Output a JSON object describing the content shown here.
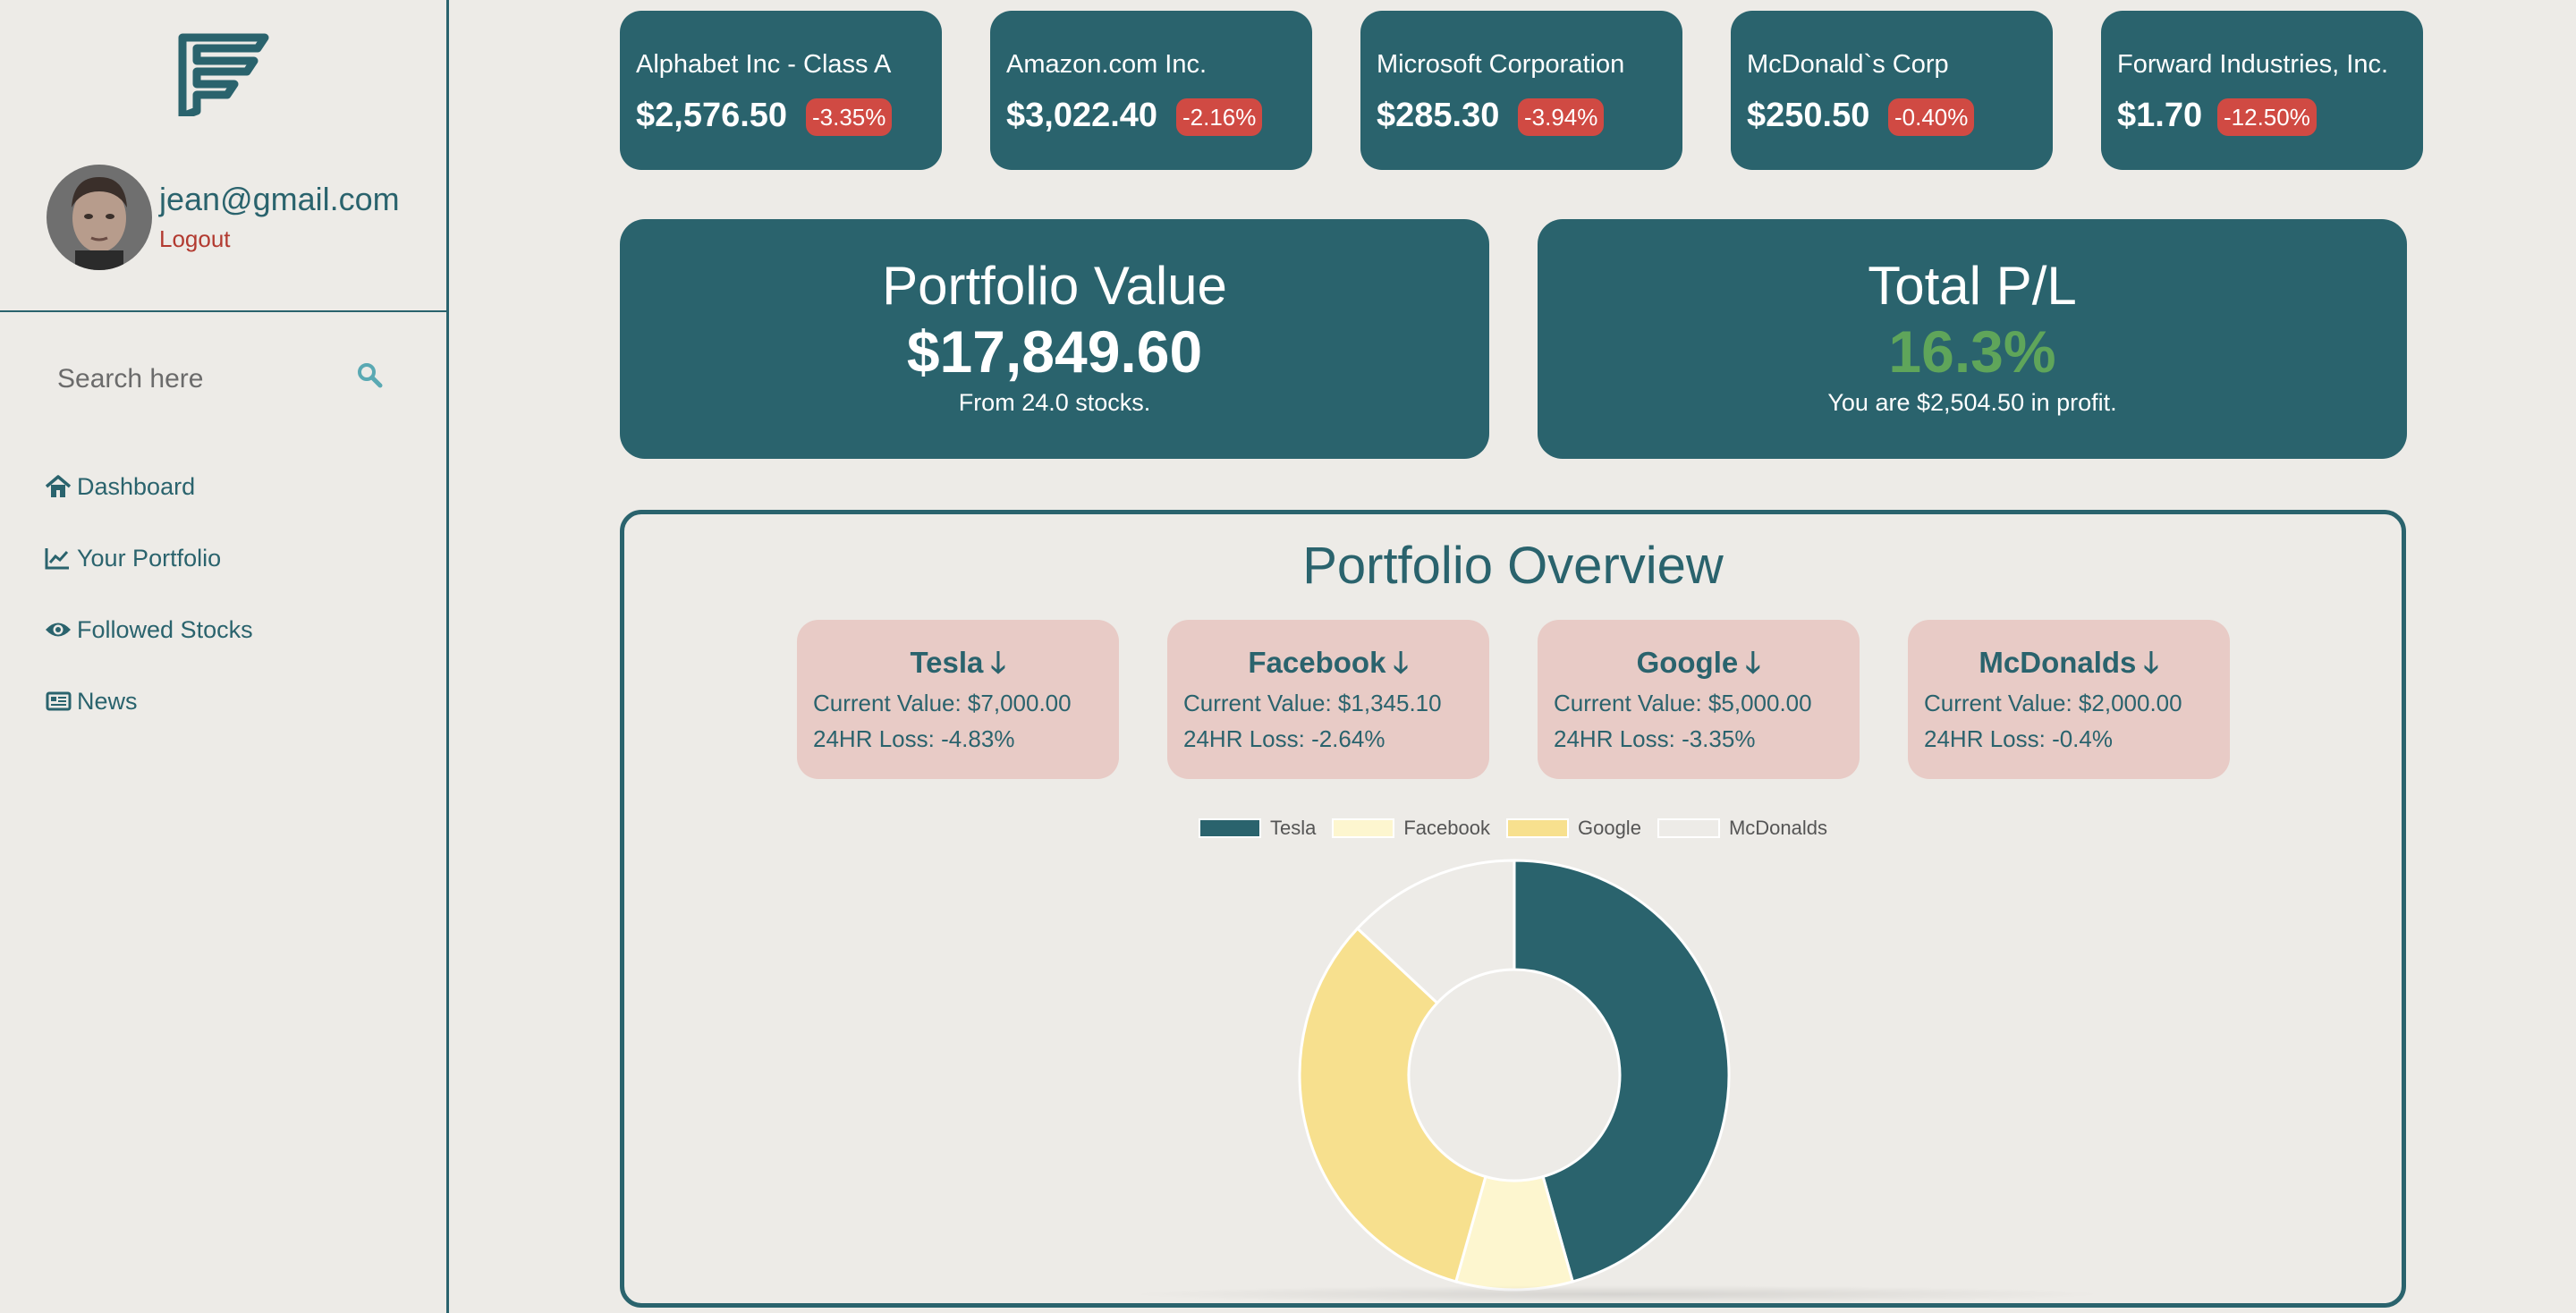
{
  "user": {
    "email": "jean@gmail.com",
    "logout_label": "Logout"
  },
  "search": {
    "placeholder": "Search here"
  },
  "nav": [
    {
      "label": "Dashboard",
      "icon": "home-icon"
    },
    {
      "label": "Your Portfolio",
      "icon": "line-chart-icon"
    },
    {
      "label": "Followed Stocks",
      "icon": "eye-icon"
    },
    {
      "label": "News",
      "icon": "newspaper-icon"
    }
  ],
  "tickers": [
    {
      "name": "Alphabet Inc - Class A",
      "price": "$2,576.50",
      "change": "-3.35%"
    },
    {
      "name": "Amazon.com Inc.",
      "price": "$3,022.40",
      "change": "-2.16%"
    },
    {
      "name": "Microsoft Corporation",
      "price": "$285.30",
      "change": "-3.94%"
    },
    {
      "name": "McDonald`s Corp",
      "price": "$250.50",
      "change": "-0.40%"
    },
    {
      "name": "Forward Industries, Inc.",
      "price": "$1.70",
      "change": "-12.50%"
    }
  ],
  "portfolio_value": {
    "title": "Portfolio Value",
    "value": "$17,849.60",
    "note": "From 24.0 stocks."
  },
  "total_pl": {
    "title": "Total P/L",
    "value": "16.3%",
    "note": "You are $2,504.50 in profit."
  },
  "overview": {
    "title": "Portfolio Overview",
    "holdings": [
      {
        "name": "Tesla",
        "current": "Current Value: $7,000.00",
        "loss": "24HR Loss: -4.83%"
      },
      {
        "name": "Facebook",
        "current": "Current Value: $1,345.10",
        "loss": "24HR Loss: -2.64%"
      },
      {
        "name": "Google",
        "current": "Current Value: $5,000.00",
        "loss": "24HR Loss: -3.35%"
      },
      {
        "name": "McDonalds",
        "current": "Current Value: $2,000.00",
        "loss": "24HR Loss: -0.4%"
      }
    ]
  },
  "colors": {
    "primary": "#2a636d",
    "background": "#edebe7",
    "negative_badge": "#d04a43",
    "positive": "#5fa55a",
    "loss_card": "#e8cbc6",
    "logout": "#b23a30"
  },
  "chart_data": {
    "type": "pie",
    "categories": [
      "Tesla",
      "Facebook",
      "Google",
      "McDonalds"
    ],
    "values": [
      7000.0,
      1345.1,
      5000.0,
      2000.0
    ],
    "colors": [
      "#2a636d",
      "#fdf6cf",
      "#f7e08e",
      "#edebe7"
    ],
    "legend": "top"
  }
}
